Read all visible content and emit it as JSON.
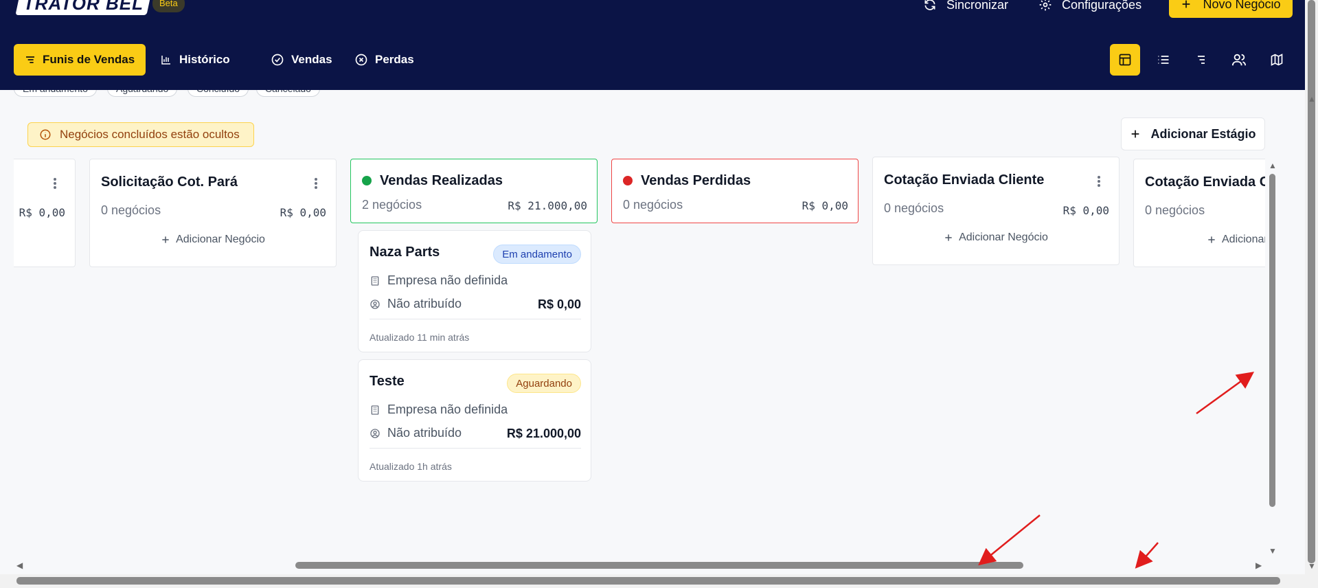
{
  "header": {
    "logo_text": "TRATOR BEL",
    "beta_label": "Beta",
    "sync_label": "Sincronizar",
    "settings_label": "Configurações",
    "new_deal_label": "Novo Negócio"
  },
  "nav": {
    "funnels_label": "Funis de Vendas",
    "history_label": "Histórico",
    "sales_label": "Vendas",
    "losses_label": "Perdas"
  },
  "view_modes": [
    "kanban-icon",
    "list-icon",
    "compact-list-icon",
    "users-icon",
    "map-icon"
  ],
  "filters": [
    "Em andamento",
    "Aguardando",
    "Concluído",
    "Cancelado"
  ],
  "notice_text": "Negócios concluídos estão ocultos",
  "add_stage_label": "Adicionar Estágio",
  "add_deal_label": "Adicionar Negócio",
  "columns": [
    {
      "title": "",
      "count": "",
      "total": "R$ 0,00"
    },
    {
      "title": "Solicitação Cot. Pará",
      "count": "0 negócios",
      "total": "R$ 0,00"
    },
    {
      "title": "Vendas Realizadas",
      "count": "2 negócios",
      "total": "R$ 21.000,00",
      "dot_color": "#16a34a"
    },
    {
      "title": "Vendas Perdidas",
      "count": "0 negócios",
      "total": "R$ 0,00",
      "dot_color": "#dc2626"
    },
    {
      "title": "Cotação Enviada Cliente",
      "count": "0 negócios",
      "total": "R$ 0,00"
    },
    {
      "title": "Cotação Enviada Cliente",
      "count": "0 negócios",
      "total": ""
    }
  ],
  "deals": [
    {
      "title": "Naza Parts",
      "status": "Em andamento",
      "company": "Empresa não definida",
      "owner": "Não atribuído",
      "value": "R$ 0,00",
      "updated": "Atualizado 11 min atrás"
    },
    {
      "title": "Teste",
      "status": "Aguardando",
      "company": "Empresa não definida",
      "owner": "Não atribuído",
      "value": "R$ 21.000,00",
      "updated": "Atualizado 1h atrás"
    }
  ],
  "colors": {
    "header_bg": "#0b1446",
    "accent": "#facc15",
    "won": "#22c55e",
    "lost": "#ef4444",
    "annotation_arrow": "#e11d1d"
  }
}
